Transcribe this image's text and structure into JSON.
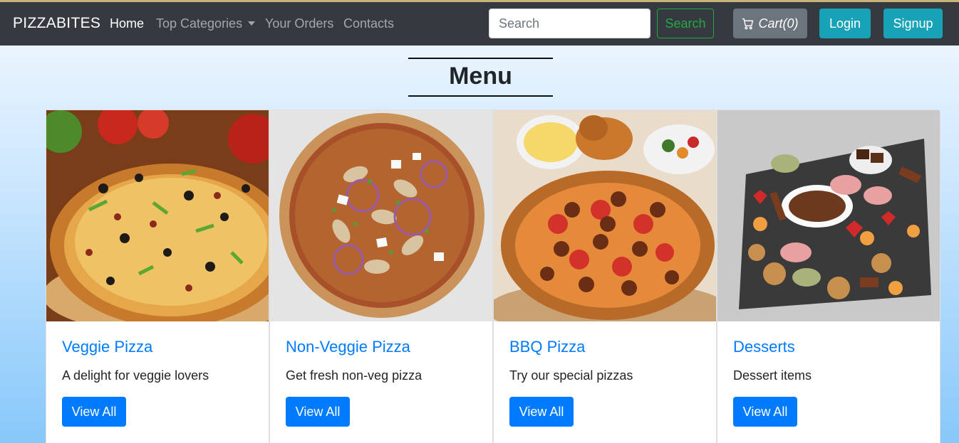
{
  "navbar": {
    "brand": "PIZZABITES",
    "links": {
      "home": "Home",
      "top_categories": "Top Categories",
      "your_orders": "Your Orders",
      "contacts": "Contacts"
    },
    "search": {
      "placeholder": "Search",
      "value": "",
      "button_label": "Search"
    },
    "cart_label": "Cart(0)",
    "login_label": "Login",
    "signup_label": "Signup"
  },
  "main": {
    "heading": "Menu",
    "cards": [
      {
        "title": "Veggie Pizza",
        "text": "A delight for veggie lovers",
        "button": "View All",
        "image": "veggie-pizza-photo"
      },
      {
        "title": "Non-Veggie Pizza",
        "text": "Get fresh non-veg pizza",
        "button": "View All",
        "image": "non-veggie-pizza-photo"
      },
      {
        "title": "BBQ Pizza",
        "text": "Try our special pizzas",
        "button": "View All",
        "image": "bbq-pizza-photo"
      },
      {
        "title": "Desserts",
        "text": "Dessert items",
        "button": "View All",
        "image": "desserts-photo"
      }
    ]
  },
  "colors": {
    "navbar_bg": "#343a40",
    "primary": "#007bff",
    "info": "#17a2b8",
    "success": "#28a745",
    "secondary": "#6c757d"
  },
  "icons": {
    "cart": "cart-icon",
    "dropdown": "caret-down-icon"
  }
}
